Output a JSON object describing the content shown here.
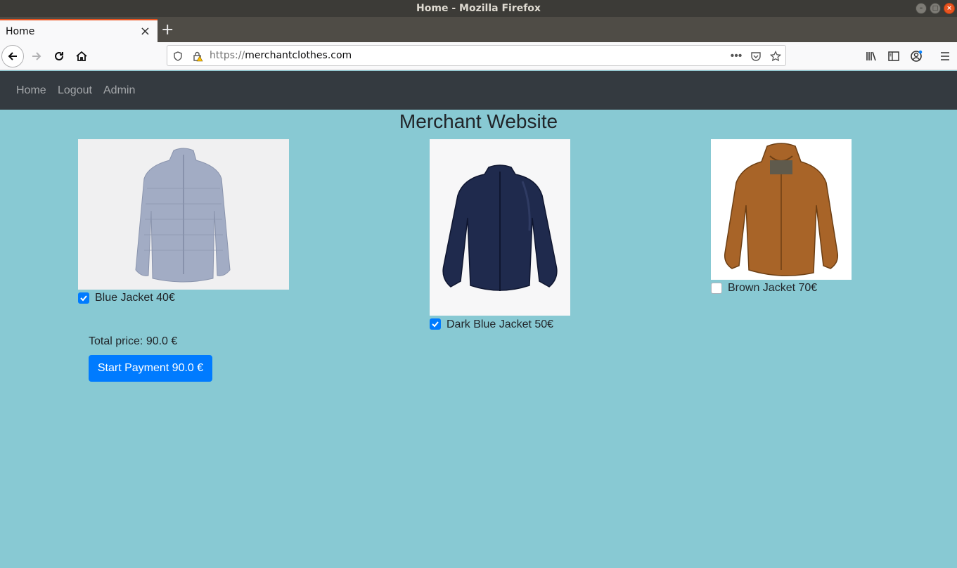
{
  "window": {
    "title": "Home - Mozilla Firefox",
    "controls": [
      "minimize-icon",
      "maximize-icon",
      "close-icon"
    ]
  },
  "browser": {
    "tab": {
      "title": "Home"
    },
    "url": {
      "protocol": "https://",
      "host": "merchantclothes.com"
    },
    "accent": "#e95420"
  },
  "site": {
    "nav": [
      "Home",
      "Logout",
      "Admin"
    ],
    "title": "Merchant Website",
    "background": "#88c9d3",
    "products": [
      {
        "label": "Blue Jacket 40€",
        "checked": true,
        "color": "#a2acc4"
      },
      {
        "label": "Dark Blue Jacket 50€",
        "checked": true,
        "color": "#1f2a4d"
      },
      {
        "label": "Brown Jacket 70€",
        "checked": false,
        "color": "#a86428"
      }
    ],
    "total": "Total price: 90.0 €",
    "payment_button": "Start Payment 90.0 €",
    "button_color": "#007bff"
  }
}
